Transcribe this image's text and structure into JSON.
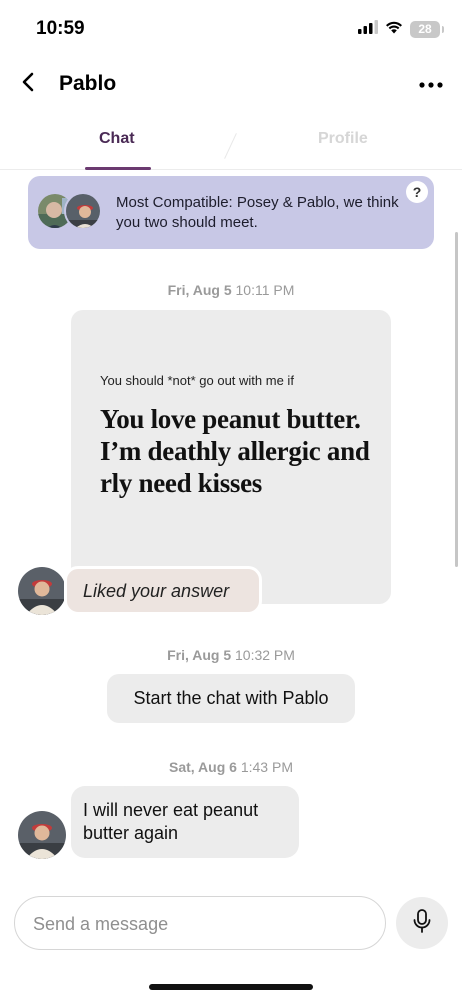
{
  "status_bar": {
    "time": "10:59",
    "battery": "28"
  },
  "nav": {
    "title": "Pablo"
  },
  "tabs": [
    {
      "label": "Chat",
      "active": true
    },
    {
      "label": "Profile",
      "active": false
    }
  ],
  "banner": {
    "text": "Most Compatible: Posey & Pablo, we think you two should meet.",
    "help_label": "?",
    "color": "#c8c8e6"
  },
  "messages": {
    "ts1": {
      "date": "Fri, Aug 5",
      "time": "10:11 PM"
    },
    "prompt": {
      "question": "You should *not* go out with me if",
      "answer": "You love peanut butter. I’m deathly allergic and rly need kisses"
    },
    "liked": "Liked your answer",
    "ts2": {
      "date": "Fri, Aug 5",
      "time": "10:32 PM"
    },
    "start_chat": "Start the chat with Pablo",
    "ts3": {
      "date": "Sat, Aug 6",
      "time": "1:43 PM"
    },
    "last_message": "I will never eat peanut butter again"
  },
  "composer": {
    "placeholder": "Send a message"
  },
  "colors": {
    "accent": "#6b3a70",
    "bubble": "#ececec",
    "liked_bubble": "#ede4e0"
  }
}
